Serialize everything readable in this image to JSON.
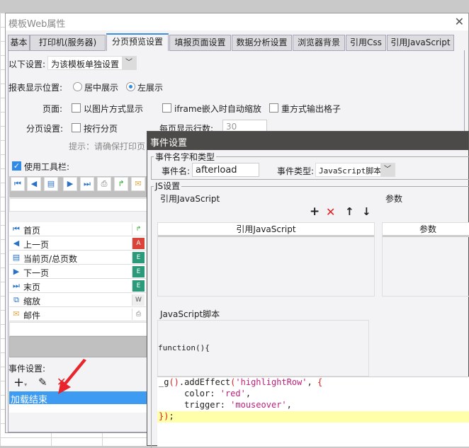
{
  "main_dialog": {
    "title": "模板Web属性",
    "tabs": [
      "基本",
      "打印机(服务器)",
      "分页预览设置",
      "填报页面设置",
      "数据分析设置",
      "浏览器背景",
      "引用Css",
      "引用JavaScript"
    ],
    "active_tab": "分页预览设置",
    "settings_label": "以下设置:",
    "settings_value": "为该模板单独设置",
    "position_label": "报表显示位置:",
    "position_options": [
      "居中展示",
      "左展示"
    ],
    "position_selected": "左展示",
    "page_label": "页面:",
    "page_options": [
      "以图片方式显示",
      "iframe嵌入时自动缩放",
      "重方式输出格子"
    ],
    "paging_label": "分页设置:",
    "paging_option": "按行分页",
    "rows_label": "每页显示行数:",
    "rows_value": "30",
    "hint": "提示：请确保打印页",
    "toolbar_label": "使用工具栏:",
    "toolbar_items": [
      {
        "icon": "first-page-icon",
        "label": "首页"
      },
      {
        "icon": "prev-page-icon",
        "label": "上一页"
      },
      {
        "icon": "page-count-icon",
        "label": "当前页/总页数"
      },
      {
        "icon": "next-page-icon",
        "label": "下一页"
      },
      {
        "icon": "last-page-icon",
        "label": "末页"
      },
      {
        "icon": "zoom-icon",
        "label": "缩放"
      },
      {
        "icon": "mail-icon",
        "label": "邮件"
      }
    ],
    "event_label": "事件设置:",
    "events": [
      "加载结束"
    ]
  },
  "event_dialog": {
    "title": "事件设置",
    "name_type_legend": "事件名字和类型",
    "name_label": "事件名:",
    "name_value": "afterload",
    "type_label": "事件类型:",
    "type_value": "JavaScript脚本",
    "js_legend": "JS设置",
    "ref_js_label": "引用JavaScript",
    "params_label": "参数",
    "ref_js_header": "引用JavaScript",
    "params_header": "参数",
    "script_label": "JavaScript脚本",
    "function_header": "function(){",
    "code": {
      "l1a": "_g",
      "l1b": "()",
      ".l1c": "",
      "l1_method": ".addEffect",
      "l1_paren": "(",
      "l1_str": "'highlightRow'",
      "l1_comma": ", ",
      "l1_brace": "{",
      "l2_key": "     color: ",
      "l2_str": "'red'",
      "l2_end": ",",
      "l3_key": "     trigger: ",
      "l3_str": "'mouseover'",
      "l3_end": ",",
      "l4_close": "})",
      "l4_end": ";"
    }
  },
  "colors": {
    "accent": "#3d9bf2",
    "title_bar": "#4c4a48",
    "highlight_line": "#ffffaa",
    "string": "#c0207a",
    "arrow": "#e8252c"
  }
}
